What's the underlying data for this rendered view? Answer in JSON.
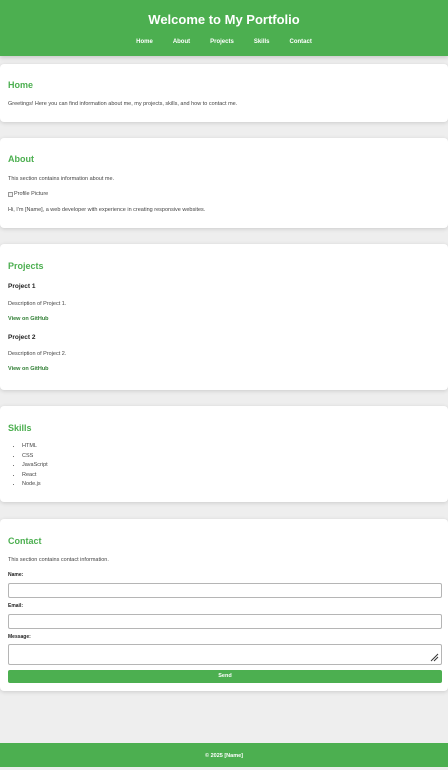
{
  "header": {
    "title": "Welcome to My Portfolio",
    "nav": [
      "Home",
      "About",
      "Projects",
      "Skills",
      "Contact"
    ]
  },
  "home": {
    "heading": "Home",
    "text": "Greetings! Here you can find information about me, my projects, skills, and how to contact me."
  },
  "about": {
    "heading": "About",
    "intro": "This section contains information about me.",
    "image_alt": "Profile Picture",
    "bio": "Hi, I'm [Name], a web developer with experience in creating responsive websites."
  },
  "projects": {
    "heading": "Projects",
    "items": [
      {
        "title": "Project 1",
        "description": "Description of Project 1.",
        "link": "View on GitHub"
      },
      {
        "title": "Project 2",
        "description": "Description of Project 2.",
        "link": "View on GitHub"
      }
    ]
  },
  "skills": {
    "heading": "Skills",
    "items": [
      "HTML",
      "CSS",
      "JavaScript",
      "React",
      "Node.js"
    ]
  },
  "contact": {
    "heading": "Contact",
    "intro": "This section contains contact information.",
    "name_label": "Name:",
    "name_value": "",
    "email_label": "Email:",
    "email_value": "",
    "message_label": "Message:",
    "message_value": "",
    "send_label": "Send"
  },
  "footer": {
    "text": "© 2025 [Name]"
  },
  "colors": {
    "accent": "#4caf50",
    "link": "#2e7d32",
    "background": "#eeeeee"
  }
}
